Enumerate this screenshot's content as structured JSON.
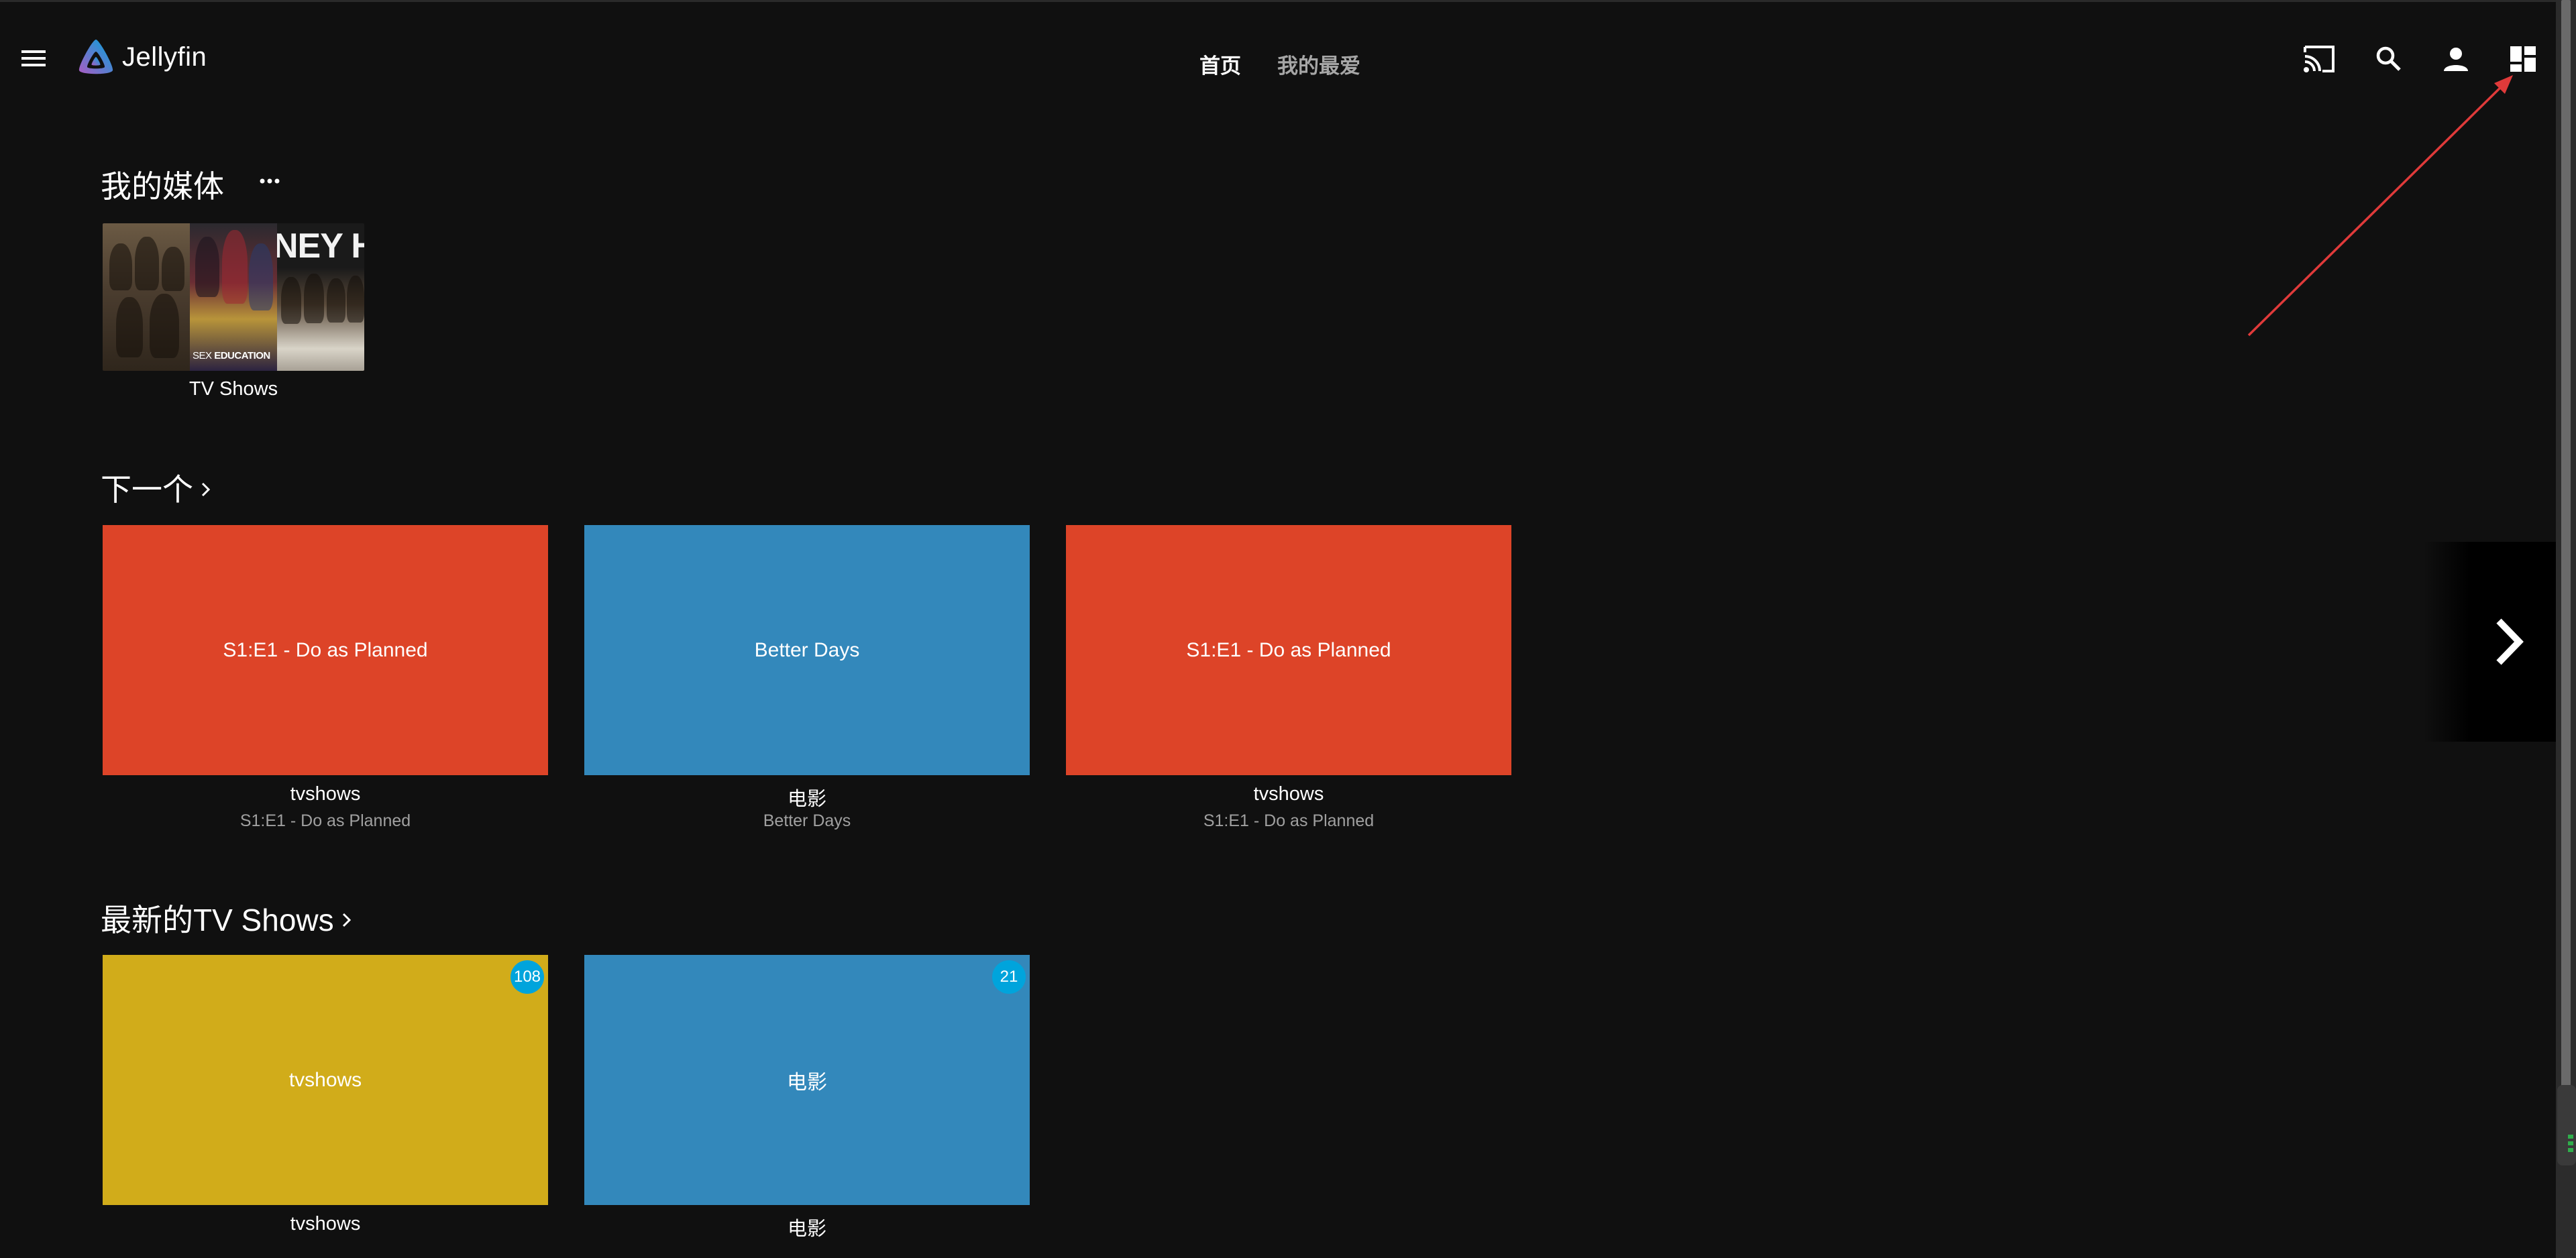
{
  "header": {
    "brand": "Jellyfin",
    "tabs": [
      {
        "label": "首页",
        "active": true
      },
      {
        "label": "我的最爱",
        "active": false
      }
    ],
    "icons": [
      "cast-icon",
      "search-icon",
      "user-icon",
      "dashboard-icon"
    ]
  },
  "my_media": {
    "title": "我的媒体",
    "libraries": [
      {
        "label": "TV Shows",
        "poster_texts": [
          "SEX EDUCATION",
          "NEY HE"
        ]
      }
    ]
  },
  "next_up": {
    "title": "下一个",
    "cards": [
      {
        "image_text": "S1:E1 - Do as Planned",
        "title": "tvshows",
        "subtitle": "S1:E1 - Do as Planned",
        "color": "#dd4428"
      },
      {
        "image_text": "Better Days",
        "title": "电影",
        "subtitle": "Better Days",
        "color": "#3388bb"
      },
      {
        "image_text": "S1:E1 - Do as Planned",
        "title": "tvshows",
        "subtitle": "S1:E1 - Do as Planned",
        "color": "#dd4428"
      }
    ]
  },
  "latest_tv": {
    "title": "最新的TV Shows",
    "cards": [
      {
        "image_text": "tvshows",
        "title": "tvshows",
        "badge": "108",
        "color": "#d1ac1a"
      },
      {
        "image_text": "电影",
        "title": "电影",
        "badge": "21",
        "color": "#3388bb"
      }
    ]
  },
  "colors": {
    "background": "#101010",
    "accent": "#00a4dc",
    "annotation_arrow": "#e03a3a"
  }
}
